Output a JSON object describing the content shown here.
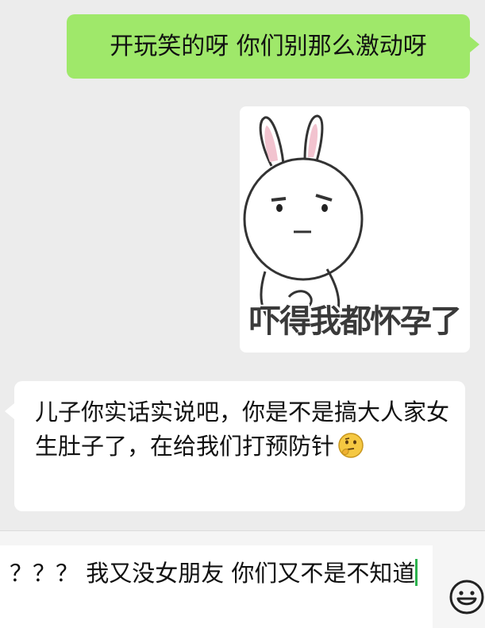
{
  "messages": [
    {
      "from": "me",
      "type": "text",
      "text": "开玩笑的呀 你们别那么激动呀"
    },
    {
      "from": "me",
      "type": "sticker",
      "caption": "吓得我都怀孕了"
    },
    {
      "from": "other",
      "type": "text",
      "text": "儿子你实话实说吧，你是不是搞大人家女生肚子了，在给我们打预防针"
    }
  ],
  "input": {
    "value": "？？？ 我又没女朋友 你们又不是不知道"
  },
  "colors": {
    "background": "#ececec",
    "outgoing_bubble": "#9fe86a",
    "incoming_bubble": "#ffffff",
    "caret": "#2bb24c"
  },
  "icons": [
    "thinking-emoji-icon",
    "emoji-keyboard-icon"
  ]
}
